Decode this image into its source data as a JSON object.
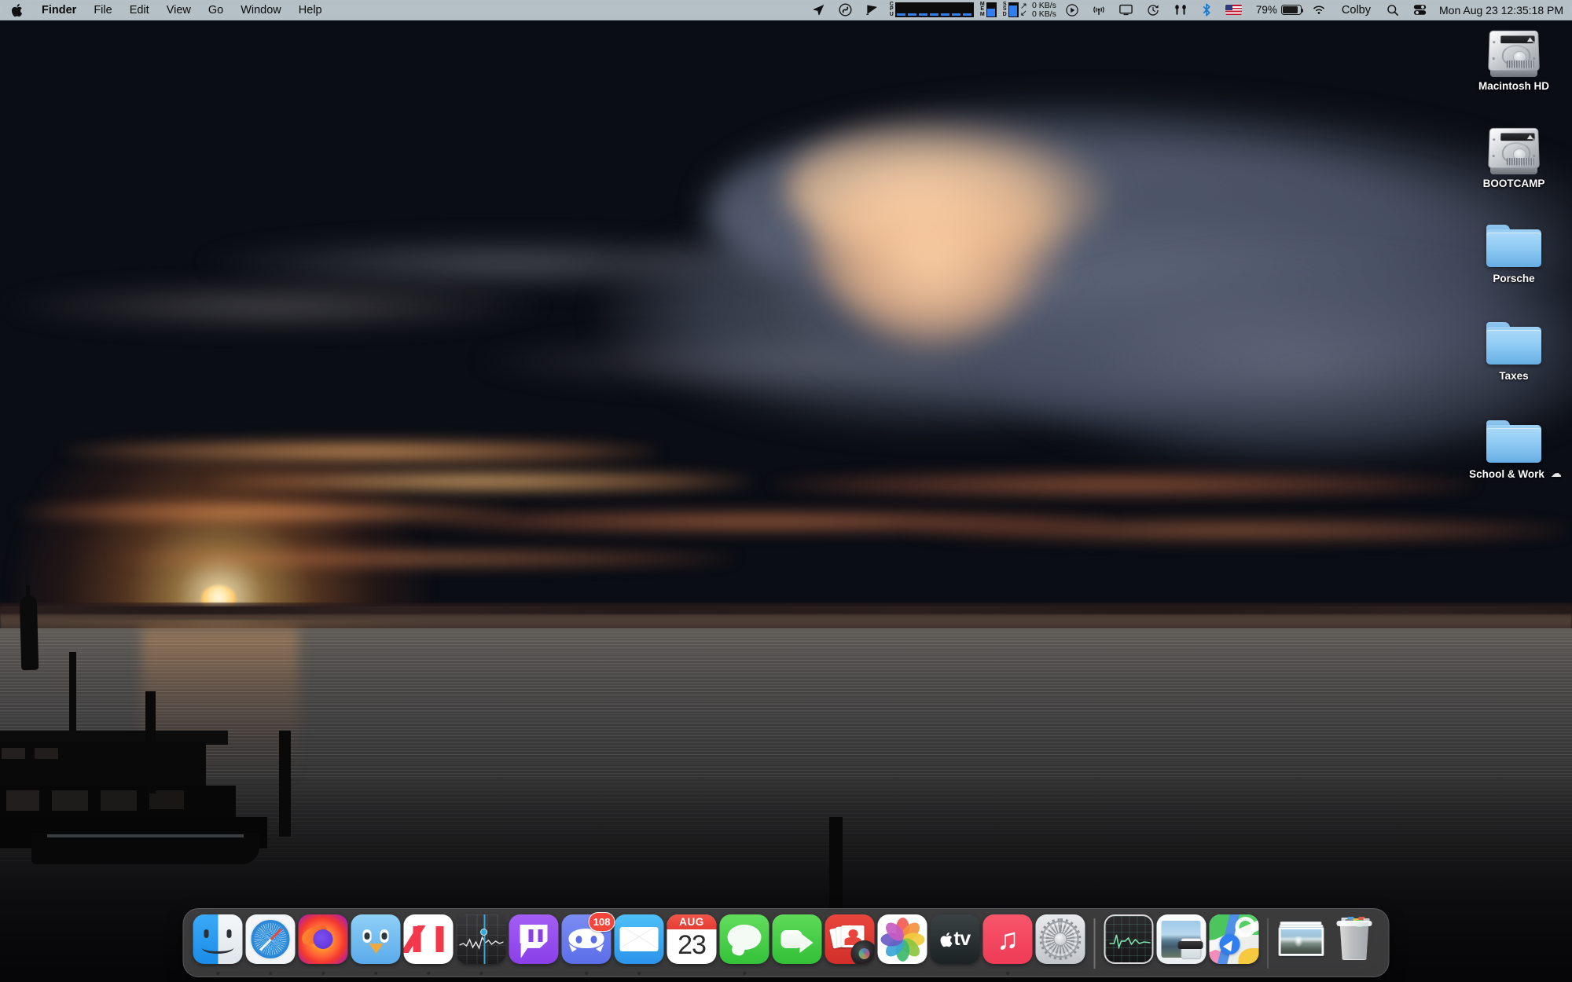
{
  "menubar": {
    "apple_logo": "apple-logo",
    "items": [
      {
        "label": "Finder",
        "bold": true
      },
      {
        "label": "File",
        "bold": false
      },
      {
        "label": "Edit",
        "bold": false
      },
      {
        "label": "View",
        "bold": false
      },
      {
        "label": "Go",
        "bold": false
      },
      {
        "label": "Window",
        "bold": false
      },
      {
        "label": "Help",
        "bold": false
      }
    ],
    "status": {
      "location_icon": "location-arrow-icon",
      "creative_cloud_icon": "adobe-creative-cloud-icon",
      "display_capture_icon": "screen-capture-icon",
      "cpu_label": "CPU",
      "mem_label": "MEM",
      "ssd_label": "SSD",
      "net_down": "0 KB/s",
      "net_up": "0 KB/s",
      "playback_icon": "play-circle-icon",
      "airdrop_icon": "airdrop-icon",
      "screen_mirroring_icon": "screen-mirroring-icon",
      "time_machine_icon": "time-machine-icon",
      "airpods_icon": "airpods-icon",
      "bluetooth_icon": "bluetooth-icon",
      "input_source_icon": "us-flag-icon",
      "battery_percent": "79%",
      "battery_icon": "battery-icon",
      "wifi_icon": "wifi-icon",
      "user_name": "Colby",
      "search_icon": "search-icon",
      "control_center_icon": "control-center-icon",
      "clock": "Mon Aug 23  12:35:18 PM"
    }
  },
  "desktop": {
    "icons": [
      {
        "label": "Macintosh HD",
        "type": "hard-drive",
        "cloud": false
      },
      {
        "label": "BOOTCAMP",
        "type": "hard-drive",
        "cloud": false
      },
      {
        "label": "Porsche",
        "type": "folder",
        "cloud": false
      },
      {
        "label": "Taxes",
        "type": "folder",
        "cloud": false
      },
      {
        "label": "School & Work",
        "type": "folder",
        "cloud": true,
        "cloud_glyph": "☁"
      }
    ]
  },
  "dock": {
    "items": [
      {
        "name": "Finder",
        "running": true
      },
      {
        "name": "Safari",
        "running": true
      },
      {
        "name": "Firefox",
        "running": true
      },
      {
        "name": "Tweetbot",
        "running": true
      },
      {
        "name": "News",
        "running": true
      },
      {
        "name": "Stocks",
        "running": true
      },
      {
        "name": "Twitch",
        "running": false
      },
      {
        "name": "Discord",
        "running": true,
        "badge": "108"
      },
      {
        "name": "Mail",
        "running": true
      },
      {
        "name": "Calendar",
        "running": false,
        "month": "AUG",
        "day": "23"
      },
      {
        "name": "Messages",
        "running": true
      },
      {
        "name": "FaceTime",
        "running": false
      },
      {
        "name": "Photo Booth",
        "running": false
      },
      {
        "name": "Photos",
        "running": false
      },
      {
        "name": "TV",
        "running": false,
        "text": "tv"
      },
      {
        "name": "Music",
        "running": true
      },
      {
        "name": "System Preferences",
        "running": false
      },
      {
        "name": "Activity Monitor",
        "running": false
      },
      {
        "name": "Preview",
        "running": false
      },
      {
        "name": "Maps",
        "running": false
      }
    ],
    "stack_name": "Pictures Stack",
    "trash_name": "Trash"
  }
}
